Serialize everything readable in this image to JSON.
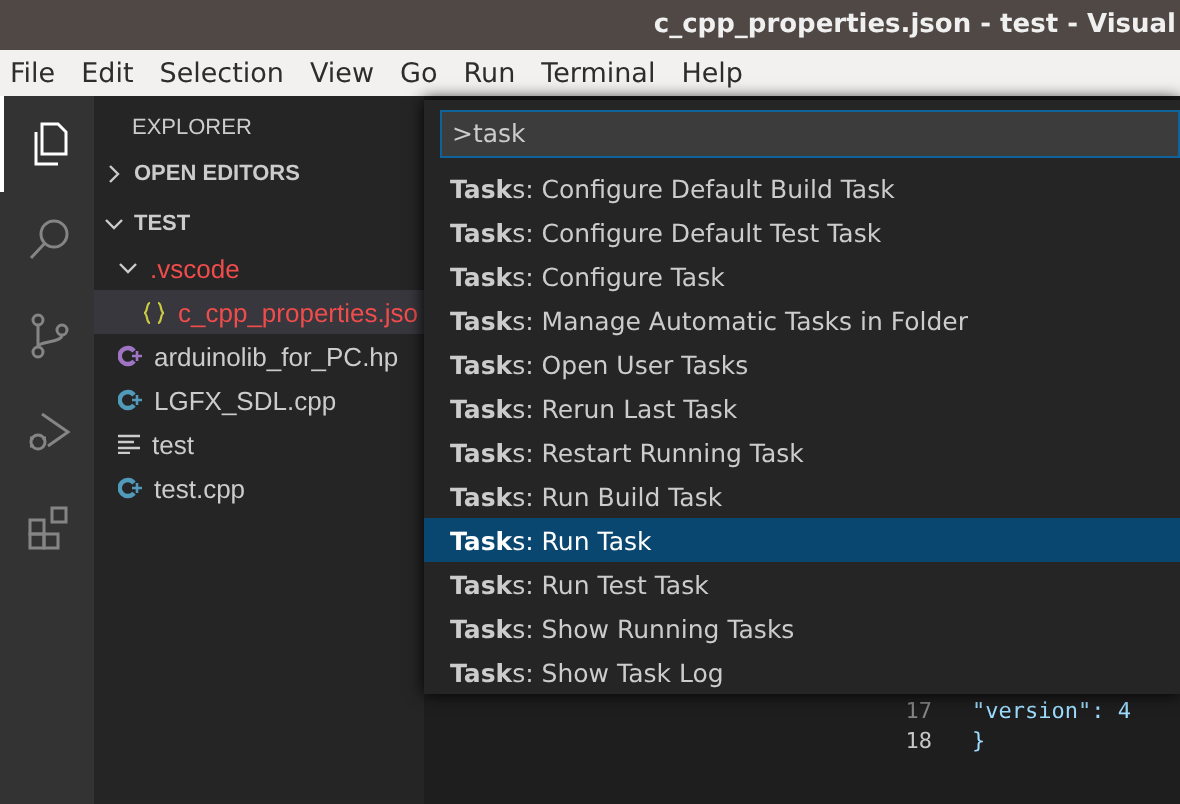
{
  "window": {
    "title": "c_cpp_properties.json - test - Visual"
  },
  "menu": [
    "File",
    "Edit",
    "Selection",
    "View",
    "Go",
    "Run",
    "Terminal",
    "Help"
  ],
  "activity_bar": [
    {
      "kind": "files",
      "selected": true
    },
    {
      "kind": "search",
      "selected": false
    },
    {
      "kind": "scm",
      "selected": false
    },
    {
      "kind": "debug",
      "selected": false
    },
    {
      "kind": "extensions",
      "selected": false
    }
  ],
  "sidebar": {
    "title": "EXPLORER",
    "sections": [
      {
        "label": "OPEN EDITORS",
        "expanded": false
      },
      {
        "label": "TEST",
        "expanded": true,
        "children": [
          {
            "label": ".vscode",
            "kind": "folder",
            "expanded": true,
            "color": "#f14c4c",
            "selected": false,
            "children": [
              {
                "label": "c_cpp_properties.jso",
                "kind": "json",
                "color": "#f14c4c",
                "selected": true
              }
            ]
          },
          {
            "label": "arduinolib_for_PC.hp",
            "kind": "cpp-header",
            "color": "#cccccc",
            "selected": false
          },
          {
            "label": "LGFX_SDL.cpp",
            "kind": "cpp",
            "color": "#cccccc",
            "selected": false
          },
          {
            "label": "test",
            "kind": "text",
            "color": "#cccccc",
            "selected": false
          },
          {
            "label": "test.cpp",
            "kind": "cpp",
            "color": "#cccccc",
            "selected": false
          }
        ]
      }
    ]
  },
  "editor": {
    "lines": [
      {
        "number": "17",
        "code": "\"version\": 4",
        "current": false
      },
      {
        "number": "18",
        "code": "}",
        "current": true
      }
    ]
  },
  "command_palette": {
    "value": ">task",
    "items": [
      {
        "label": "**Task**s: Configure Default Build Task",
        "selected": false
      },
      {
        "label": "**Task**s: Configure Default Test Task",
        "selected": false
      },
      {
        "label": "**Task**s: Configure Task",
        "selected": false
      },
      {
        "label": "**Task**s: Manage Automatic Tasks in Folder",
        "selected": false
      },
      {
        "label": "**Task**s: Open User Tasks",
        "selected": false
      },
      {
        "label": "**Task**s: Rerun Last Task",
        "selected": false
      },
      {
        "label": "**Task**s: Restart Running Task",
        "selected": false
      },
      {
        "label": "**Task**s: Run Build Task",
        "selected": false
      },
      {
        "label": "**Task**s: Run Task",
        "selected": true
      },
      {
        "label": "**Task**s: Run Test Task",
        "selected": false
      },
      {
        "label": "**Task**s: Show Running Tasks",
        "selected": false
      },
      {
        "label": "**Task**s: Show Task Log",
        "selected": false
      }
    ]
  }
}
